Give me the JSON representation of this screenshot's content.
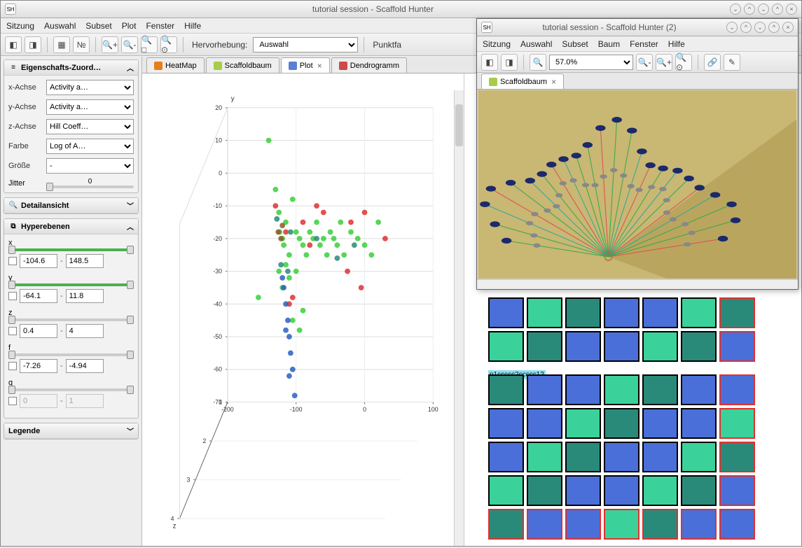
{
  "main": {
    "title": "tutorial session - Scaffold Hunter",
    "menubar": [
      "Sitzung",
      "Auswahl",
      "Subset",
      "Plot",
      "Fenster",
      "Hilfe"
    ],
    "highlight_label": "Hervorhebung:",
    "highlight_value": "Auswahl",
    "right_label": "Punktfa"
  },
  "tabs": [
    {
      "label": "HeatMap",
      "icon": "#e57f1a"
    },
    {
      "label": "Scaffoldbaum",
      "icon": "#a8cc4a"
    },
    {
      "label": "Plot",
      "icon": "#5b7fd1",
      "active": true,
      "closable": true
    },
    {
      "label": "Dendrogramm",
      "icon": "#cc4a4a"
    }
  ],
  "sidebar": {
    "props_title": "Eigenschafts-Zuord…",
    "x_label": "x-Achse",
    "x_value": "Activity a…",
    "y_label": "y-Achse",
    "y_value": "Activity a…",
    "z_label": "z-Achse",
    "z_value": "Hill Coeff…",
    "color_label": "Farbe",
    "color_value": "Log of A…",
    "size_label": "Größe",
    "size_value": "-",
    "jitter_label": "Jitter",
    "jitter_value": "0",
    "detail_title": "Detailansicht",
    "hyper_title": "Hyperebenen",
    "x": {
      "label": "x",
      "min": "-104.6",
      "max": "148.5"
    },
    "y": {
      "label": "y",
      "min": "-64.1",
      "max": "11.8"
    },
    "z": {
      "label": "z",
      "min": "0.4",
      "max": "4"
    },
    "f": {
      "label": "f",
      "min": "-7.26",
      "max": "-4.94"
    },
    "g": {
      "label": "g",
      "min": "0",
      "max": "1"
    },
    "legend_title": "Legende"
  },
  "chart_data": {
    "type": "scatter",
    "title": "",
    "xlabel": "",
    "ylabel": "y",
    "zlabel": "z",
    "x_range": [
      -200,
      100
    ],
    "x_ticks": [
      -200,
      -100,
      0,
      100
    ],
    "y_range": [
      -70,
      20
    ],
    "y_ticks": [
      20,
      10,
      0,
      -10,
      -20,
      -30,
      -40,
      -50,
      -60,
      -70
    ],
    "z_range": [
      1,
      4
    ],
    "z_ticks": [
      1,
      2,
      3,
      4
    ],
    "color_legend": "Log of A…",
    "series": [
      {
        "name": "green",
        "color": "#3bcf3b",
        "points": [
          [
            -140,
            10
          ],
          [
            -130,
            -5
          ],
          [
            -125,
            -12
          ],
          [
            -124,
            -18
          ],
          [
            -120,
            -20
          ],
          [
            -115,
            -15
          ],
          [
            -118,
            -22
          ],
          [
            -110,
            -25
          ],
          [
            -105,
            -8
          ],
          [
            -100,
            -18
          ],
          [
            -95,
            -20
          ],
          [
            -90,
            -22
          ],
          [
            -85,
            -25
          ],
          [
            -80,
            -18
          ],
          [
            -75,
            -20
          ],
          [
            -70,
            -15
          ],
          [
            -65,
            -22
          ],
          [
            -60,
            -20
          ],
          [
            -55,
            -25
          ],
          [
            -50,
            -18
          ],
          [
            -45,
            -20
          ],
          [
            -40,
            -22
          ],
          [
            -35,
            -15
          ],
          [
            -30,
            -25
          ],
          [
            -20,
            -18
          ],
          [
            -10,
            -20
          ],
          [
            0,
            -22
          ],
          [
            10,
            -25
          ],
          [
            20,
            -15
          ],
          [
            -125,
            -30
          ],
          [
            -120,
            -35
          ],
          [
            -115,
            -28
          ],
          [
            -110,
            -32
          ],
          [
            -100,
            -30
          ],
          [
            -155,
            -38
          ],
          [
            -105,
            -45
          ],
          [
            -95,
            -48
          ],
          [
            -90,
            -42
          ]
        ]
      },
      {
        "name": "red",
        "color": "#e03030",
        "points": [
          [
            -130,
            -10
          ],
          [
            -115,
            -18
          ],
          [
            -90,
            -15
          ],
          [
            -60,
            -12
          ],
          [
            -80,
            -22
          ],
          [
            -20,
            -15
          ],
          [
            0,
            -12
          ],
          [
            30,
            -20
          ],
          [
            -110,
            -40
          ],
          [
            -105,
            -38
          ],
          [
            -25,
            -30
          ],
          [
            -5,
            -35
          ],
          [
            -70,
            -10
          ]
        ]
      },
      {
        "name": "teal",
        "color": "#2a8a7a",
        "points": [
          [
            -128,
            -14
          ],
          [
            -108,
            -18
          ],
          [
            -70,
            -20
          ],
          [
            -15,
            -22
          ],
          [
            -40,
            -26
          ],
          [
            -112,
            -30
          ],
          [
            -122,
            -28
          ]
        ]
      },
      {
        "name": "blue",
        "color": "#2a5fc0",
        "points": [
          [
            -118,
            -35
          ],
          [
            -115,
            -40
          ],
          [
            -112,
            -45
          ],
          [
            -110,
            -50
          ],
          [
            -108,
            -55
          ],
          [
            -105,
            -60
          ],
          [
            -110,
            -62
          ],
          [
            -115,
            -48
          ],
          [
            -120,
            -32
          ],
          [
            -102,
            -68
          ]
        ]
      },
      {
        "name": "brown",
        "color": "#8a5a2a",
        "points": [
          [
            -126,
            -18
          ],
          [
            -120,
            -16
          ],
          [
            -122,
            -20
          ]
        ]
      }
    ]
  },
  "treemap": {
    "smiles_label": "n1ccccc2ccccc12"
  },
  "secondary": {
    "title": "tutorial session - Scaffold Hunter (2)",
    "menubar": [
      "Sitzung",
      "Auswahl",
      "Subset",
      "Baum",
      "Fenster",
      "Hilfe"
    ],
    "zoom": "57.0%",
    "tab_label": "Scaffoldbaum"
  }
}
